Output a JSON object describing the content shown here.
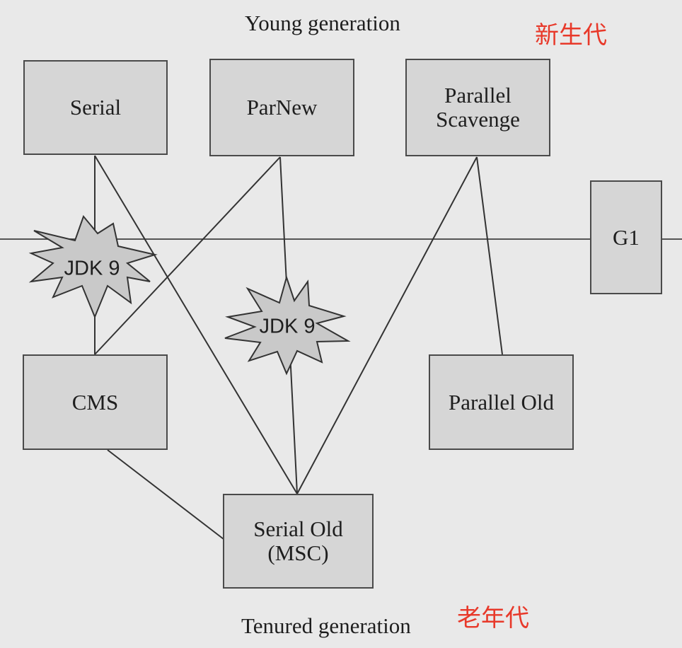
{
  "labels": {
    "young_generation": "Young generation",
    "young_generation_cn": "新生代",
    "tenured_generation": "Tenured generation",
    "tenured_generation_cn": "老年代"
  },
  "collectors": {
    "serial": "Serial",
    "parnew": "ParNew",
    "parallel_scavenge": "Parallel\nScavenge",
    "g1": "G1",
    "cms": "CMS",
    "parallel_old": "Parallel Old",
    "serial_old": "Serial Old\n(MSC)"
  },
  "deprecations": {
    "left": "JDK 9",
    "center": "JDK 9"
  },
  "colors": {
    "background": "#e9e9e9",
    "box_fill": "#d6d6d6",
    "chinese_label": "#e8392a"
  }
}
